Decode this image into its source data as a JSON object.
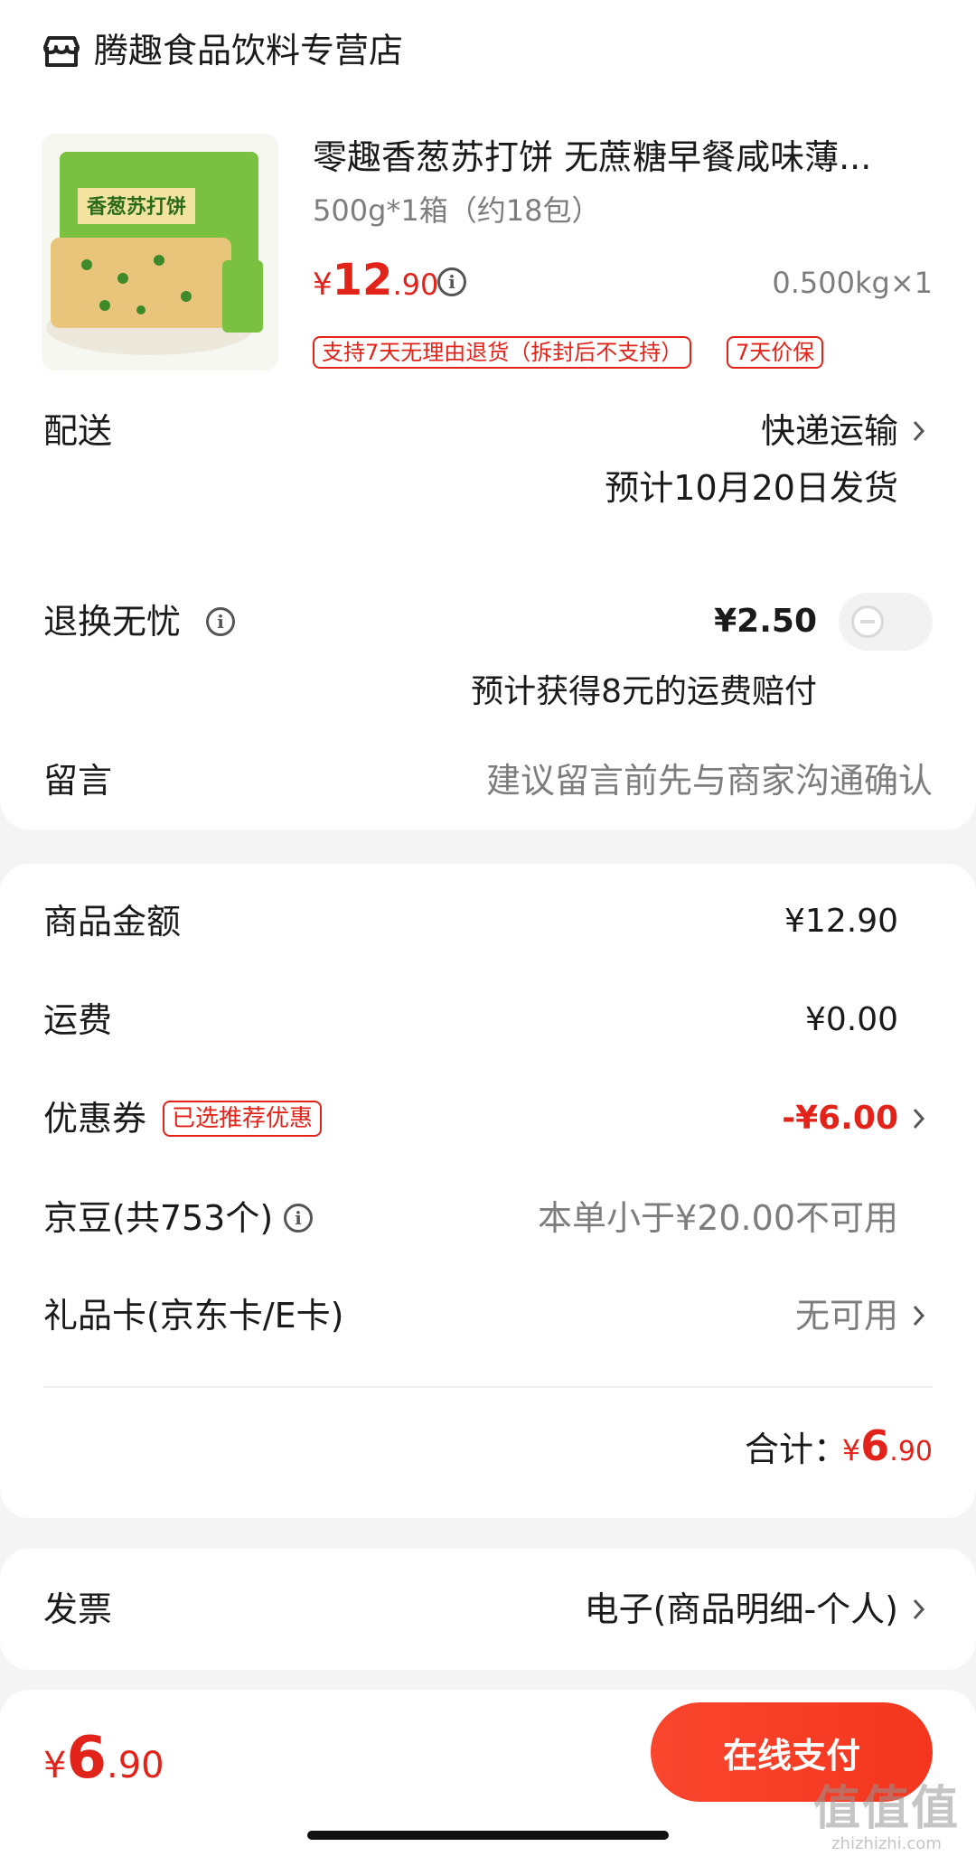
{
  "store": {
    "name": "腾趣食品饮料专营店",
    "icon": "shop-icon"
  },
  "product": {
    "title": "零趣香葱苏打饼 无蔗糖早餐咸味薄...",
    "spec": "500g*1箱（约18包）",
    "price_currency": "¥",
    "price_int": "12",
    "price_dec": ".90",
    "quantity": "0.500kg×1",
    "tags": [
      "支持7天无理由退货（拆封后不支持）",
      "7天价保"
    ],
    "image_text": "香葱苏打饼"
  },
  "delivery": {
    "label": "配送",
    "method": "快递运输",
    "estimate": "预计10月20日发货"
  },
  "return_insurance": {
    "label": "退换无忧",
    "price": "¥2.50",
    "note": "预计获得8元的运费赔付",
    "enabled": false
  },
  "message": {
    "label": "留言",
    "placeholder": "建议留言前先与商家沟通确认"
  },
  "summary": {
    "goods_label": "商品金额",
    "goods_value": "¥12.90",
    "shipping_label": "运费",
    "shipping_value": "¥0.00",
    "coupon_label": "优惠券",
    "coupon_tag": "已选推荐优惠",
    "coupon_value": "-¥6.00",
    "beans_label": "京豆(共753个)",
    "beans_value": "本单小于¥20.00不可用",
    "giftcard_label": "礼品卡(京东卡/E卡)",
    "giftcard_value": "无可用",
    "total_label": "合计：",
    "total_currency": "¥",
    "total_int": "6",
    "total_dec": ".90"
  },
  "invoice": {
    "label": "发票",
    "value": "电子(商品明细-个人)"
  },
  "bottom": {
    "currency": "¥",
    "int": "6",
    "dec": ".90",
    "pay_button": "在线支付"
  },
  "watermark": {
    "line1": "值值值",
    "line2": "zhizhizhi.com"
  },
  "colors": {
    "accent": "#e2231a",
    "button": "#f4361e"
  }
}
